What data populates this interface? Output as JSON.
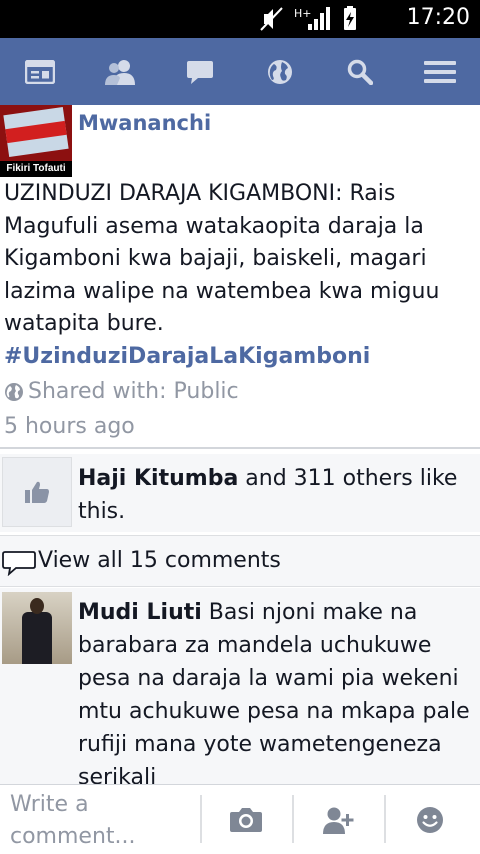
{
  "status_bar": {
    "time": "17:20",
    "network": "H+",
    "icons": [
      "mute-icon",
      "signal-icon",
      "battery-charging-icon"
    ]
  },
  "nav": {
    "items": [
      "news-feed-icon",
      "friends-icon",
      "messages-icon",
      "notifications-globe-icon",
      "search-icon",
      "menu-icon"
    ],
    "bg_color": "#4e69a2"
  },
  "post": {
    "page_name": "Mwananchi",
    "avatar_caption": "Fikiri Tofauti",
    "text_lines": [
      "UZINDUZI DARAJA KIGAMBONI: Rais",
      "Magufuli asema watakaopita daraja la",
      "Kigamboni kwa bajaji, baiskeli, magari",
      "lazima walipe na watembea kwa miguu",
      "watapita bure."
    ],
    "hashtag": "#UzinduziDarajaLaKigamboni",
    "privacy": "Shared with: Public",
    "time_ago": "5 hours ago"
  },
  "likes": {
    "name": "Haji Kitumba",
    "rest": " and 311 others like this."
  },
  "comments": {
    "view_all": "View all 15 comments",
    "items": [
      {
        "author": "Mudi Liuti",
        "text": " Basi njoni make na barabara za mandela uchukuwe pesa na daraja la wami pia wekeni mtu achukuwe pesa na mkapa pale rufiji mana yote wametengeneza serikali"
      }
    ]
  },
  "composer": {
    "placeholder": "Write a comment...",
    "buttons": [
      "camera-icon",
      "tag-friend-icon",
      "emoji-icon"
    ]
  }
}
